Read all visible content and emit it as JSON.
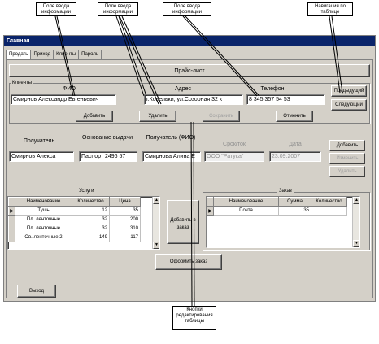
{
  "callouts": {
    "input1": "Поле ввода информации",
    "input2": "Поле ввода информации",
    "input3": "Поле ввода информации",
    "nav": "Навигация по таблице",
    "edit": "Кнопки редактирования таблицы"
  },
  "window": {
    "title": "Главная"
  },
  "tabs": [
    "Продать",
    "Приход",
    "Клиенты",
    "Пароль"
  ],
  "price_button": "Прайс-лист",
  "clients": {
    "group_title": "Клиенты",
    "fio_label": "ФИО",
    "address_label": "Адрес",
    "phone_label": "Телефон",
    "fio_value": "Смирнов Александр Евгеньевич",
    "address_value": "г.Ковельки, ул.Созорная 32 к",
    "phone_value": "8 345 357 54 53",
    "add": "Добавить",
    "delete": "Удалить",
    "save": "Сохранить",
    "cancel": "Отменить",
    "prev": "Предыдущий",
    "next": "Следующий"
  },
  "order": {
    "recipient_label": "Получатель",
    "basis_label": "Основание выдачи",
    "received_label": "Получатель (ФИО)",
    "deadline_label": "Срок/ток",
    "date_label": "Дата",
    "recipient_value": "Смирнов Алекса",
    "basis_value": "Паспорт 2496 57",
    "received_value": "Смирнова Алина Е",
    "deadline_value": "ООО \"Ратука\"",
    "date_value": "23.09.2007",
    "add": "Добавить",
    "change": "Изменить",
    "remove": "Удалить"
  },
  "services": {
    "title": "Услуги",
    "columns": [
      "Наименование",
      "Количество",
      "Цена"
    ],
    "rows": [
      [
        "Тушь",
        "12",
        "35"
      ],
      [
        "Пл. ленточные",
        "32",
        "200"
      ],
      [
        "Пл. ленточные",
        "32",
        "310"
      ],
      [
        "Ов. ленточные 2",
        "149",
        "117"
      ]
    ],
    "add_to_order": "Добавить в заказ"
  },
  "order_table": {
    "title": "Заказ",
    "columns": [
      "Наименование",
      "Сумма",
      "Количество"
    ],
    "rows": [
      [
        "Почта",
        "35",
        ""
      ]
    ]
  },
  "place_order": "Оформить заказ",
  "exit": "Выход"
}
